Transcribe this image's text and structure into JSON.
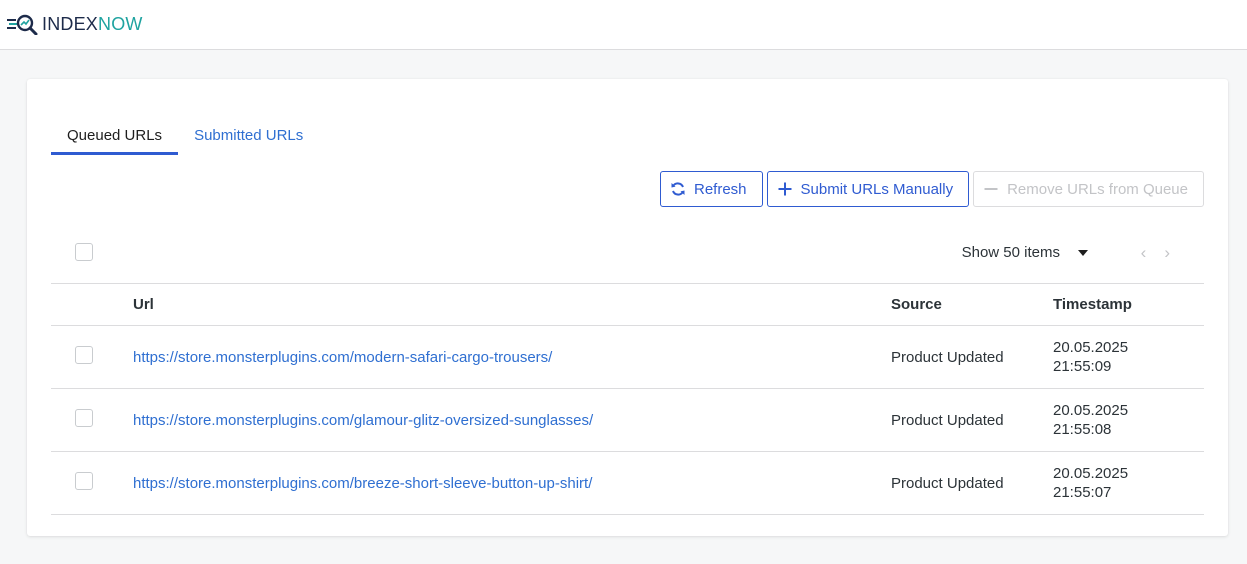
{
  "app": {
    "logo_part1": "INDEX",
    "logo_part2": "NOW",
    "logo_icon": "magnifier-speed-icon"
  },
  "tabs": [
    {
      "label": "Queued URLs",
      "active": true
    },
    {
      "label": "Submitted URLs",
      "active": false
    }
  ],
  "toolbar": {
    "refresh_label": "Refresh",
    "refresh_icon": "refresh-icon",
    "submit_label": "Submit URLs Manually",
    "submit_icon": "plus-icon",
    "remove_label": "Remove URLs from Queue",
    "remove_icon": "minus-icon",
    "remove_disabled": true
  },
  "list": {
    "show_items_label": "Show 50 items",
    "prev_icon": "chevron-left-icon",
    "next_icon": "chevron-right-icon"
  },
  "table": {
    "columns": [
      "Url",
      "Source",
      "Timestamp"
    ],
    "rows": [
      {
        "url": "https://store.monsterplugins.com/modern-safari-cargo-trousers/",
        "source": "Product Updated",
        "date": "20.05.2025",
        "time": "21:55:09"
      },
      {
        "url": "https://store.monsterplugins.com/glamour-glitz-oversized-sunglasses/",
        "source": "Product Updated",
        "date": "20.05.2025",
        "time": "21:55:08"
      },
      {
        "url": "https://store.monsterplugins.com/breeze-short-sleeve-button-up-shirt/",
        "source": "Product Updated",
        "date": "20.05.2025",
        "time": "21:55:07"
      }
    ]
  },
  "colors": {
    "accent": "#2f5bd1",
    "link": "#2f6fd1",
    "logo_dark": "#1d2b4a",
    "logo_teal": "#1fa3a0",
    "disabled": "#c3c4c7",
    "border": "#dcdcde"
  }
}
